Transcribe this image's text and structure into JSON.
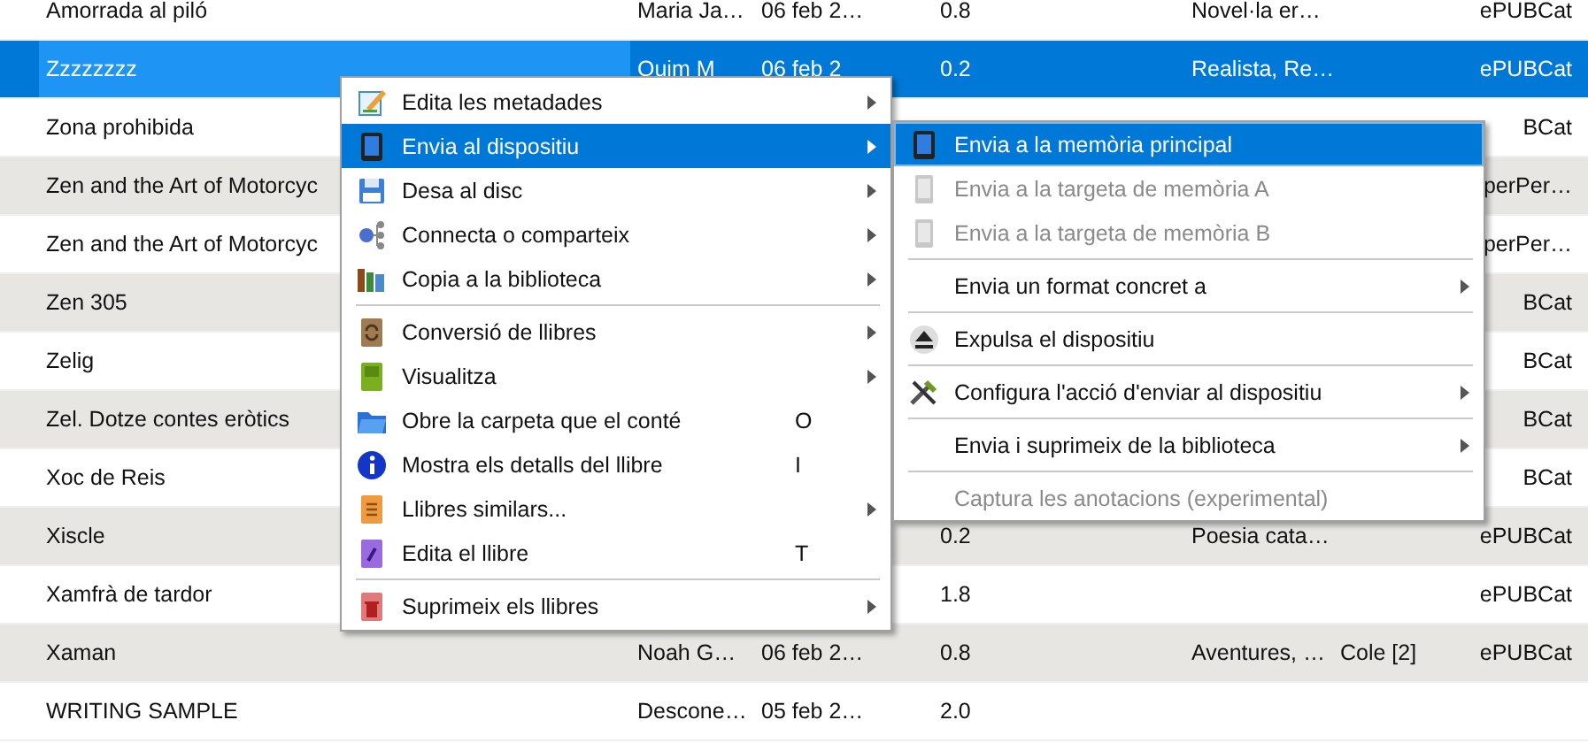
{
  "books": [
    {
      "title": "Amorrada al piló",
      "author": "Maria Ja…",
      "date": "06 feb 2…",
      "size": "0.8",
      "tags": "Novel·la er…",
      "publisher": "ePUBCat",
      "selected": false
    },
    {
      "title": "Zzzzzzzz",
      "author": "Quim M",
      "date": "06 feb 2",
      "size": "0.2",
      "tags": "Realista, Re…",
      "publisher": "ePUBCat",
      "selected": true
    },
    {
      "title": "Zona prohibida",
      "publisher": "BCat",
      "selected": false
    },
    {
      "title": "Zen and the Art of Motorcyc",
      "publisher": "perPer…",
      "selected": false
    },
    {
      "title": "Zen and the Art of Motorcyc",
      "publisher": "perPer…",
      "selected": false
    },
    {
      "title": "Zen 305",
      "publisher": "BCat",
      "selected": false
    },
    {
      "title": "Zelig",
      "publisher": "BCat",
      "selected": false
    },
    {
      "title": "Zel. Dotze contes eròtics",
      "publisher": "BCat",
      "selected": false
    },
    {
      "title": "Xoc de Reis",
      "publisher": "BCat",
      "selected": false
    },
    {
      "title": "Xiscle",
      "size": "0.2",
      "tags": "Poesia cata…",
      "publisher": "ePUBCat",
      "selected": false
    },
    {
      "title": "Xamfrà de tardor",
      "size": "1.8",
      "publisher": "ePUBCat",
      "selected": false
    },
    {
      "title": "Xaman",
      "author": "Noah G…",
      "date": "06 feb 2…",
      "size": "0.8",
      "tags": "Aventures, …",
      "series": "Cole [2]",
      "publisher": "ePUBCat",
      "selected": false
    },
    {
      "title": "WRITING SAMPLE",
      "author": "Descone…",
      "date": "05 feb 2…",
      "size": "2.0",
      "selected": false
    }
  ],
  "context_menu": {
    "items": [
      {
        "kind": "item",
        "label": "Edita les metadades",
        "has_submenu": true,
        "selected": false
      },
      {
        "kind": "item",
        "label": "Envia al dispositiu",
        "has_submenu": true,
        "selected": true
      },
      {
        "kind": "item",
        "label": "Desa al disc",
        "has_submenu": true,
        "selected": false
      },
      {
        "kind": "item",
        "label": "Connecta o comparteix",
        "has_submenu": true,
        "selected": false
      },
      {
        "kind": "item",
        "label": "Copia a la biblioteca",
        "has_submenu": true,
        "selected": false
      },
      {
        "kind": "separator"
      },
      {
        "kind": "item",
        "label": "Conversió de llibres",
        "has_submenu": true,
        "selected": false
      },
      {
        "kind": "item",
        "label": "Visualitza",
        "has_submenu": true,
        "selected": false
      },
      {
        "kind": "item",
        "label": "Obre la carpeta que el conté",
        "shortcut": "O",
        "has_submenu": false,
        "selected": false
      },
      {
        "kind": "item",
        "label": "Mostra els detalls del llibre",
        "shortcut": "I",
        "has_submenu": false,
        "selected": false
      },
      {
        "kind": "item",
        "label": "Llibres similars...",
        "has_submenu": true,
        "selected": false
      },
      {
        "kind": "item",
        "label": "Edita el llibre",
        "shortcut": "T",
        "has_submenu": false,
        "selected": false
      },
      {
        "kind": "separator"
      },
      {
        "kind": "item",
        "label": "Suprimeix els llibres",
        "has_submenu": true,
        "selected": false
      }
    ]
  },
  "submenu": {
    "items": [
      {
        "kind": "item",
        "label": "Envia a la memòria principal",
        "has_submenu": false,
        "disabled": false,
        "selected": true
      },
      {
        "kind": "item",
        "label": "Envia a la targeta de memòria A",
        "has_submenu": false,
        "disabled": true,
        "selected": false
      },
      {
        "kind": "item",
        "label": "Envia a la targeta de memòria B",
        "has_submenu": false,
        "disabled": true,
        "selected": false
      },
      {
        "kind": "separator"
      },
      {
        "kind": "item",
        "label": "Envia un format concret a",
        "has_submenu": true,
        "disabled": false,
        "selected": false
      },
      {
        "kind": "separator"
      },
      {
        "kind": "item",
        "label": "Expulsa el dispositiu",
        "has_submenu": false,
        "disabled": false,
        "selected": false
      },
      {
        "kind": "separator"
      },
      {
        "kind": "item",
        "label": "Configura l'acció d'enviar al dispositiu",
        "has_submenu": true,
        "disabled": false,
        "selected": false
      },
      {
        "kind": "separator"
      },
      {
        "kind": "item",
        "label": "Envia i suprimeix de la biblioteca",
        "has_submenu": true,
        "disabled": false,
        "selected": false
      },
      {
        "kind": "separator"
      },
      {
        "kind": "item",
        "label": "Captura les anotacions (experimental)",
        "has_submenu": false,
        "disabled": true,
        "selected": false
      }
    ]
  }
}
